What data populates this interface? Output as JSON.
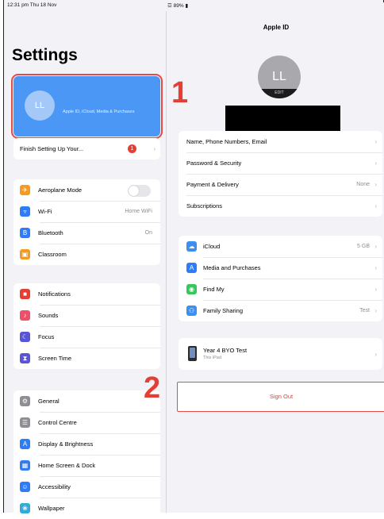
{
  "status_bar": {
    "time": "12:31 pm  Thu 18 Nov",
    "right": "☲ 89% ▮"
  },
  "left": {
    "title": "Settings",
    "profile": {
      "initials": "LL",
      "subtitle": "Apple ID, iCloud, Media & Purchases"
    },
    "finish_setup": {
      "label": "Finish Setting Up Your...",
      "badge": "1"
    },
    "group1": [
      {
        "icon": "airplane-icon",
        "color": "#f59a23",
        "glyph": "✈",
        "label": "Aeroplane Mode",
        "toggle": true
      },
      {
        "icon": "wifi-icon",
        "color": "#2f7df6",
        "glyph": "▿",
        "label": "Wi-Fi",
        "value": "Home WiFi"
      },
      {
        "icon": "bluetooth-icon",
        "color": "#2f7df6",
        "glyph": "B",
        "label": "Bluetooth",
        "value": "On"
      },
      {
        "icon": "classroom-icon",
        "color": "#f59a23",
        "glyph": "▣",
        "label": "Classroom"
      }
    ],
    "group2": [
      {
        "icon": "notifications-icon",
        "color": "#e53e35",
        "glyph": "■",
        "label": "Notifications"
      },
      {
        "icon": "sounds-icon",
        "color": "#ef4f6a",
        "glyph": "♪",
        "label": "Sounds"
      },
      {
        "icon": "focus-icon",
        "color": "#5856d6",
        "glyph": "☾",
        "label": "Focus"
      },
      {
        "icon": "screen-time-icon",
        "color": "#5856d6",
        "glyph": "⧗",
        "label": "Screen Time"
      }
    ],
    "group3": [
      {
        "icon": "general-icon",
        "color": "#8e8e93",
        "glyph": "⚙",
        "label": "General"
      },
      {
        "icon": "control-centre-icon",
        "color": "#8e8e93",
        "glyph": "☰",
        "label": "Control Centre"
      },
      {
        "icon": "display-icon",
        "color": "#2f7df6",
        "glyph": "A",
        "label": "Display & Brightness"
      },
      {
        "icon": "home-screen-icon",
        "color": "#2f7df6",
        "glyph": "▦",
        "label": "Home Screen & Dock"
      },
      {
        "icon": "accessibility-icon",
        "color": "#2f7df6",
        "glyph": "☺",
        "label": "Accessibility"
      },
      {
        "icon": "wallpaper-icon",
        "color": "#34aadc",
        "glyph": "❀",
        "label": "Wallpaper"
      }
    ]
  },
  "right": {
    "title": "Apple ID",
    "avatar": {
      "initials": "LL",
      "edit": "EDIT"
    },
    "account_group": [
      {
        "label": "Name, Phone Numbers, Email"
      },
      {
        "label": "Password & Security"
      },
      {
        "label": "Payment & Delivery",
        "value": "None"
      },
      {
        "label": "Subscriptions"
      }
    ],
    "services_group": [
      {
        "icon": "icloud-icon",
        "color": "#3b8ff0",
        "glyph": "☁",
        "label": "iCloud",
        "value": "5 GB"
      },
      {
        "icon": "app-store-icon",
        "color": "#2f7df6",
        "glyph": "A",
        "label": "Media and Purchases"
      },
      {
        "icon": "find-my-icon",
        "color": "#34c759",
        "glyph": "◉",
        "label": "Find My"
      },
      {
        "icon": "family-sharing-icon",
        "color": "#3b8ff0",
        "glyph": "⚇",
        "label": "Family Sharing",
        "value": "Test"
      }
    ],
    "device": {
      "label": "Year 4 BYO Test",
      "sub": "This iPad"
    },
    "sign_out": "Sign Out"
  },
  "markers": {
    "one": "1",
    "two": "2"
  }
}
